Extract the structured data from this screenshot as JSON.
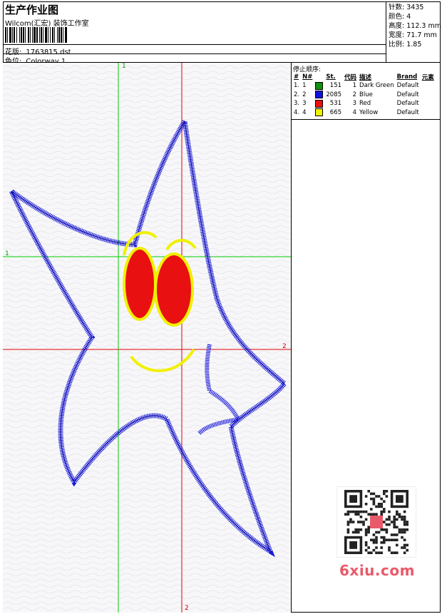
{
  "header": {
    "title": "生产作业图",
    "company": "Wilcom(汇宏) 装饰工作室",
    "design_label": "花版:",
    "design_value": "1763815.dst",
    "color_label": "色位:",
    "color_value": "Colorway 1"
  },
  "stats": {
    "stitches_label": "针数:",
    "stitches_value": "3435",
    "colors_label": "颜色:",
    "colors_value": "4",
    "height_label": "高度:",
    "height_value": "112.3 mm",
    "width_label": "宽度:",
    "width_value": "71.7 mm",
    "ratio_label": "比例:",
    "ratio_value": "1.85"
  },
  "canvas": {
    "axis_labels": {
      "top_green": "1",
      "left_green": "1",
      "right_red": "2",
      "bottom_red": "2"
    },
    "colors": {
      "outline": "#1010d0",
      "fill": "#e81010",
      "accent": "#f0f000",
      "guide_green": "#00cc00",
      "guide_red": "#e00000"
    }
  },
  "sequence": {
    "title": "停止顺序:",
    "headers": [
      "#",
      "N#",
      "St.",
      "代码",
      "描述",
      "Brand",
      "元素"
    ],
    "rows": [
      {
        "idx": "1.",
        "n": "1",
        "color": "#109010",
        "st": "151",
        "code": "1",
        "desc": "Dark Green",
        "brand": "Default"
      },
      {
        "idx": "2.",
        "n": "2",
        "color": "#1010e0",
        "st": "2085",
        "code": "2",
        "desc": "Blue",
        "brand": "Default"
      },
      {
        "idx": "3.",
        "n": "3",
        "color": "#e81010",
        "st": "531",
        "code": "3",
        "desc": "Red",
        "brand": "Default"
      },
      {
        "idx": "4.",
        "n": "4",
        "color": "#f0f000",
        "st": "665",
        "code": "4",
        "desc": "Yellow",
        "brand": "Default"
      }
    ]
  },
  "watermark": "6xiu.com"
}
